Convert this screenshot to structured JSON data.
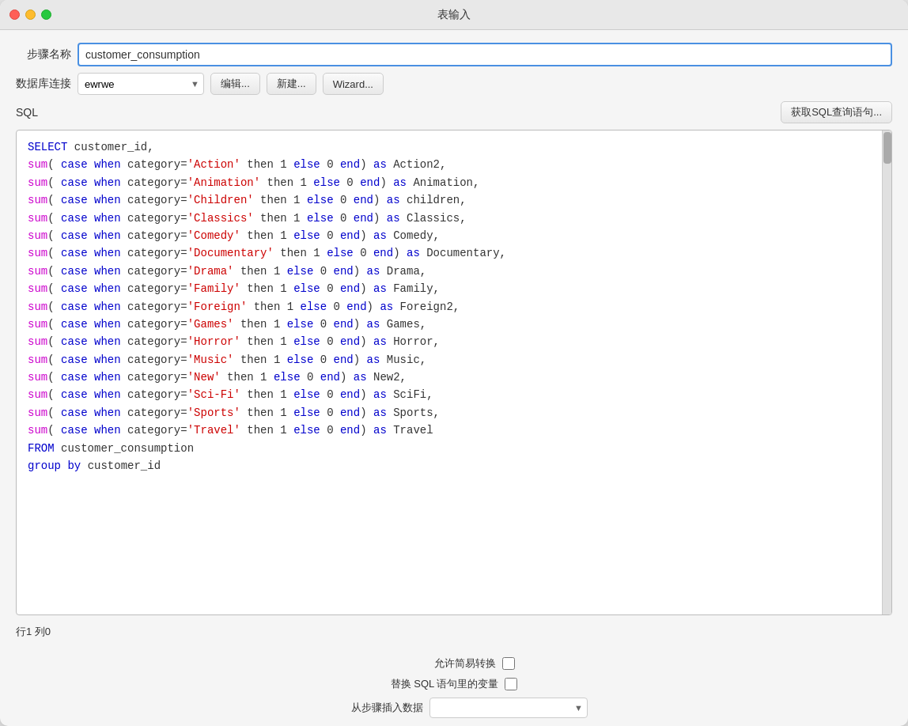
{
  "window": {
    "title": "表输入"
  },
  "form": {
    "step_name_label": "步骤名称",
    "step_name_value": "customer_consumption",
    "db_label": "数据库连接",
    "db_value": "ewrwe",
    "btn_edit": "编辑...",
    "btn_new": "新建...",
    "btn_wizard": "Wizard...",
    "btn_get_sql": "获取SQL查询语句...",
    "sql_label": "SQL",
    "status": "行1 列0",
    "checkbox1_label": "允许简易转换",
    "checkbox2_label": "替换 SQL 语句里的变量",
    "from_step_label": "从步骤插入数据"
  },
  "sql_code": [
    {
      "line": "SELECT customer_id,"
    },
    {
      "line": "sum( case when category='Action' then 1 else 0 end) as Action2,"
    },
    {
      "line": "sum( case when category='Animation' then 1 else 0 end) as Animation,"
    },
    {
      "line": "sum( case when category='Children' then 1 else 0 end) as children,"
    },
    {
      "line": "sum( case when category='Classics' then 1 else 0 end) as Classics,"
    },
    {
      "line": "sum( case when category='Comedy' then 1 else 0 end) as Comedy,"
    },
    {
      "line": "sum( case when category='Documentary' then 1 else 0 end) as Documentary,"
    },
    {
      "line": "sum( case when category='Drama' then 1 else 0 end) as Drama,"
    },
    {
      "line": "sum( case when category='Family' then 1 else 0 end) as Family,"
    },
    {
      "line": "sum( case when category='Foreign' then 1 else 0 end) as Foreign2,"
    },
    {
      "line": "sum( case when category='Games' then 1 else 0 end) as Games,"
    },
    {
      "line": "sum( case when category='Horror' then 1 else 0 end) as Horror,"
    },
    {
      "line": "sum( case when category='Music' then 1 else 0 end) as Music,"
    },
    {
      "line": "sum( case when category='New' then 1 else 0 end) as New2,"
    },
    {
      "line": "sum( case when category='Sci-Fi' then 1 else 0 end) as SciFi,"
    },
    {
      "line": "sum( case when category='Sports' then 1 else 0 end) as Sports,"
    },
    {
      "line": "sum( case when category='Travel' then 1 else 0 end) as Travel"
    },
    {
      "line": "FROM customer_consumption"
    },
    {
      "line": "group by customer_id"
    }
  ]
}
